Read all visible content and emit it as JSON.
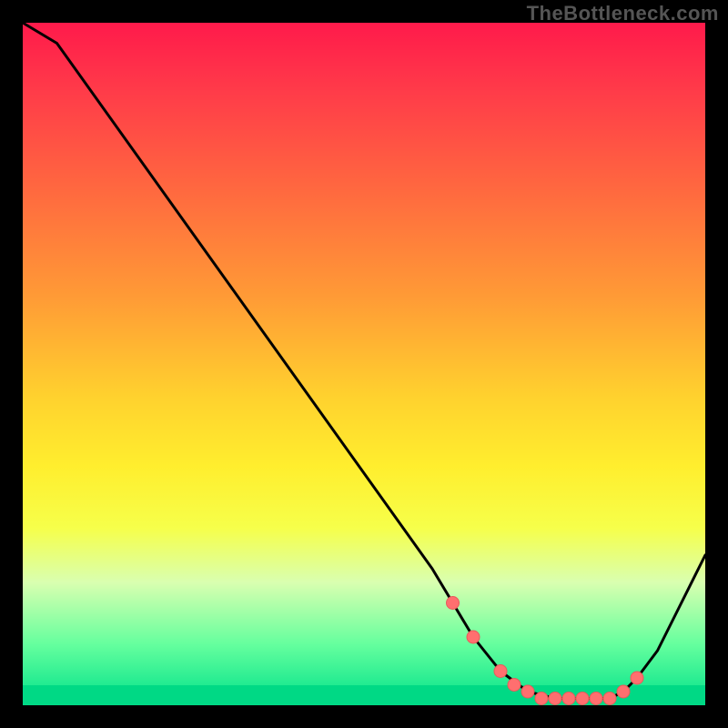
{
  "watermark": "TheBottleneck.com",
  "chart_data": {
    "type": "line",
    "title": "",
    "xlabel": "",
    "ylabel": "",
    "xlim": [
      0,
      100
    ],
    "ylim": [
      0,
      100
    ],
    "series": [
      {
        "name": "bottleneck-curve",
        "x": [
          0,
          5,
          10,
          15,
          20,
          25,
          30,
          35,
          40,
          45,
          50,
          55,
          60,
          63,
          66,
          70,
          74,
          78,
          82,
          86,
          88,
          90,
          93,
          96,
          100
        ],
        "values": [
          100,
          97,
          90,
          83,
          76,
          69,
          62,
          55,
          48,
          41,
          34,
          27,
          20,
          15,
          10,
          5,
          2,
          1,
          1,
          1,
          2,
          4,
          8,
          14,
          22
        ]
      }
    ],
    "markers": {
      "name": "highlighted-points",
      "x": [
        63,
        66,
        70,
        72,
        74,
        76,
        78,
        80,
        82,
        84,
        86,
        88,
        90
      ],
      "values": [
        15,
        10,
        5,
        3,
        2,
        1,
        1,
        1,
        1,
        1,
        1,
        2,
        4
      ]
    },
    "background_gradient": {
      "top": "#ff1a4b",
      "mid": "#ffee2e",
      "bottom": "#00d985"
    }
  }
}
